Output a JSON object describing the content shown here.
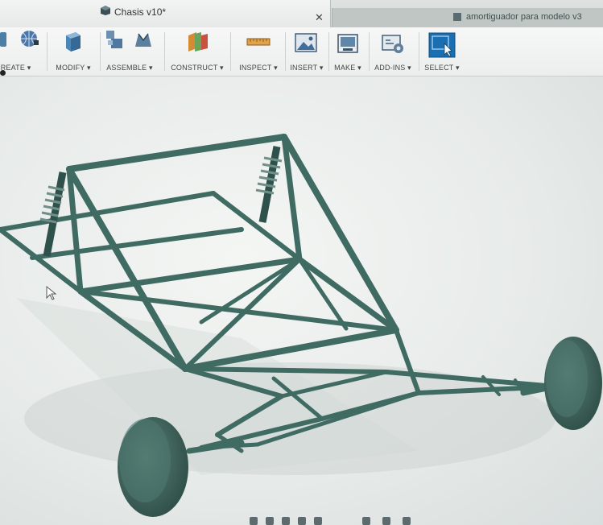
{
  "tabs": {
    "active_title": "Chasis v10*",
    "inactive_title": "amortiguador para modelo v3"
  },
  "toolbar": {
    "groups": [
      {
        "label": "CREATE ▾",
        "icon": "create-icon"
      },
      {
        "label": "MODIFY ▾",
        "icon": "modify-icon"
      },
      {
        "label": "ASSEMBLE ▾",
        "icon": "assemble-icon"
      },
      {
        "label": "CONSTRUCT ▾",
        "icon": "construct-icon"
      },
      {
        "label": "INSPECT ▾",
        "icon": "inspect-icon"
      },
      {
        "label": "INSERT ▾",
        "icon": "insert-icon"
      },
      {
        "label": "MAKE ▾",
        "icon": "make-icon"
      },
      {
        "label": "ADD-INS ▾",
        "icon": "add-ins-icon"
      },
      {
        "label": "SELECT ▾",
        "icon": "select-icon"
      }
    ]
  },
  "colors": {
    "frame": "#3f6b63",
    "frame_dark": "#2e524b",
    "wheel": "#3a5f58",
    "select_blue": "#1a6fb3"
  }
}
